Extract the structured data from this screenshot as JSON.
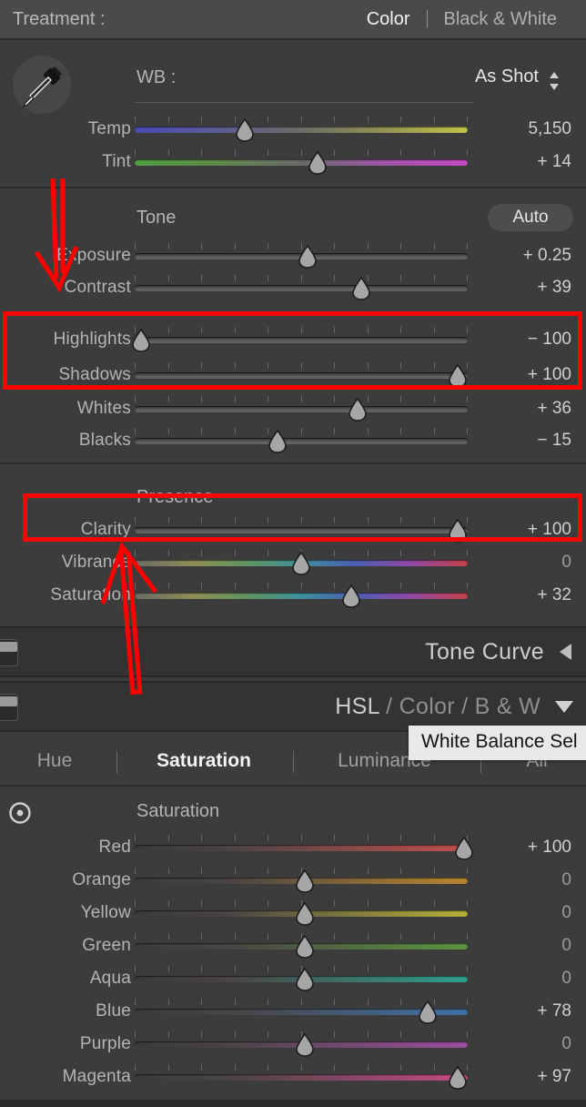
{
  "treatment": {
    "label": "Treatment :",
    "options": [
      {
        "label": "Color",
        "active": true
      },
      {
        "label": "Black & White",
        "active": false
      }
    ]
  },
  "white_balance": {
    "eyedropper_icon": "eyedropper-icon",
    "label": "WB :",
    "value": "As Shot",
    "stepper_icon": "up-down-stepper-icon",
    "sliders": [
      {
        "name": "Temp",
        "value": "5,150",
        "pos": 33,
        "gradient": "temp"
      },
      {
        "name": "Tint",
        "value": "+ 14",
        "pos": 55,
        "gradient": "tint"
      }
    ]
  },
  "tone": {
    "title": "Tone",
    "auto_label": "Auto",
    "sliders": [
      {
        "name": "Exposure",
        "value": "+ 0.25",
        "pos": 52,
        "zero": false
      },
      {
        "name": "Contrast",
        "value": "+ 39",
        "pos": 68,
        "zero": false
      },
      {
        "name": "Highlights",
        "value": "− 100",
        "pos": 2,
        "zero": false
      },
      {
        "name": "Shadows",
        "value": "+ 100",
        "pos": 97,
        "zero": false
      },
      {
        "name": "Whites",
        "value": "+ 36",
        "pos": 67,
        "zero": false
      },
      {
        "name": "Blacks",
        "value": "− 15",
        "pos": 43,
        "zero": false
      }
    ]
  },
  "presence": {
    "title": "Presence",
    "sliders": [
      {
        "name": "Clarity",
        "value": "+ 100",
        "pos": 97,
        "zero": false,
        "gradient": "none"
      },
      {
        "name": "Vibrance",
        "value": "0",
        "pos": 50,
        "zero": true,
        "gradient": "spectrum"
      },
      {
        "name": "Saturation",
        "value": "+ 32",
        "pos": 65,
        "zero": false,
        "gradient": "spectrum"
      }
    ]
  },
  "tone_curve_section": {
    "title": "Tone Curve",
    "arrow_icon": "collapse-left-arrow-icon",
    "toggle_icon": "panel-switch-icon"
  },
  "hsl_section": {
    "title_parts": [
      "HSL",
      "/",
      "Color",
      "/",
      "B & W"
    ],
    "arrow_icon": "expand-down-arrow-icon",
    "toggle_icon": "panel-switch-icon",
    "tabs": [
      {
        "label": "Hue",
        "active": false
      },
      {
        "label": "Saturation",
        "active": true
      },
      {
        "label": "Luminance",
        "active": false
      },
      {
        "label": "All",
        "active": false
      }
    ],
    "target_tool_icon": "target-adjustment-icon",
    "group_title": "Saturation",
    "sliders": [
      {
        "name": "Red",
        "value": "+ 100",
        "pos": 99,
        "zero": false,
        "color": "#c0504d"
      },
      {
        "name": "Orange",
        "value": "0",
        "pos": 51,
        "zero": true,
        "color": "#b8862f"
      },
      {
        "name": "Yellow",
        "value": "0",
        "pos": 51,
        "zero": true,
        "color": "#b5b03a"
      },
      {
        "name": "Green",
        "value": "0",
        "pos": 51,
        "zero": true,
        "color": "#5b9440"
      },
      {
        "name": "Aqua",
        "value": "0",
        "pos": 51,
        "zero": true,
        "color": "#2f9e8c"
      },
      {
        "name": "Blue",
        "value": "+ 78",
        "pos": 88,
        "zero": false,
        "color": "#3f72a8"
      },
      {
        "name": "Purple",
        "value": "0",
        "pos": 51,
        "zero": true,
        "color": "#9e4ea0"
      },
      {
        "name": "Magenta",
        "value": "+ 97",
        "pos": 97,
        "zero": false,
        "color": "#c44a86"
      }
    ]
  },
  "tooltip": {
    "text": "White Balance Sel"
  },
  "annotations": {
    "accent_color": "#ff0000",
    "boxes": [
      {
        "name": "highlights-shadows-highlight-box"
      },
      {
        "name": "clarity-highlight-box"
      }
    ],
    "arrows": [
      {
        "name": "down-arrow-to-contrast"
      },
      {
        "name": "up-arrow-to-vibrance"
      }
    ]
  }
}
